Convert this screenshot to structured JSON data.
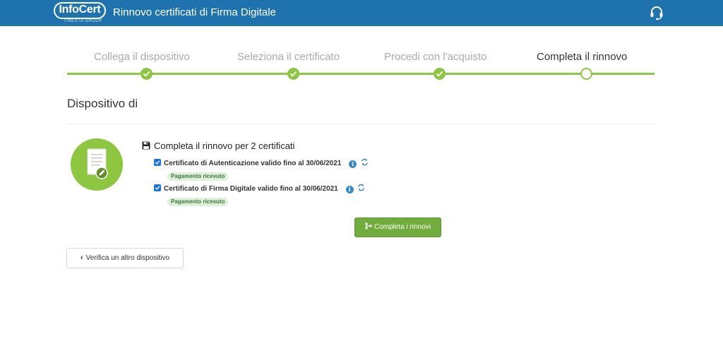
{
  "header": {
    "logo_text": "InfoCert",
    "logo_subtext": "TINEXTA GROUP",
    "title": "Rinnovo certificati di Firma Digitale"
  },
  "stepper": {
    "steps": [
      {
        "label": "Collega il dispositivo",
        "state": "done"
      },
      {
        "label": "Seleziona il certificato",
        "state": "done"
      },
      {
        "label": "Procedi con l'acquisto",
        "state": "done"
      },
      {
        "label": "Completa il rinnovo",
        "state": "active"
      }
    ]
  },
  "section": {
    "title": "Dispositivo di"
  },
  "renewal": {
    "heading": "Completa il rinnovo per 2 certificati",
    "certificates": [
      {
        "label": "Certificato di Autenticazione valido fino al 30/06/2021",
        "checked": true,
        "status": "Pagamento ricevuto"
      },
      {
        "label": "Certificato di Firma Digitale valido fino al 30/06/2021",
        "checked": true,
        "status": "Pagamento ricevuto"
      }
    ],
    "complete_button": "Completa i rinnovi"
  },
  "footer": {
    "other_device_button": "Verifica un altro dispositivo"
  },
  "colors": {
    "header_bg": "#1e72ad",
    "accent_green": "#8dc63f",
    "button_green": "#71ad3d"
  }
}
